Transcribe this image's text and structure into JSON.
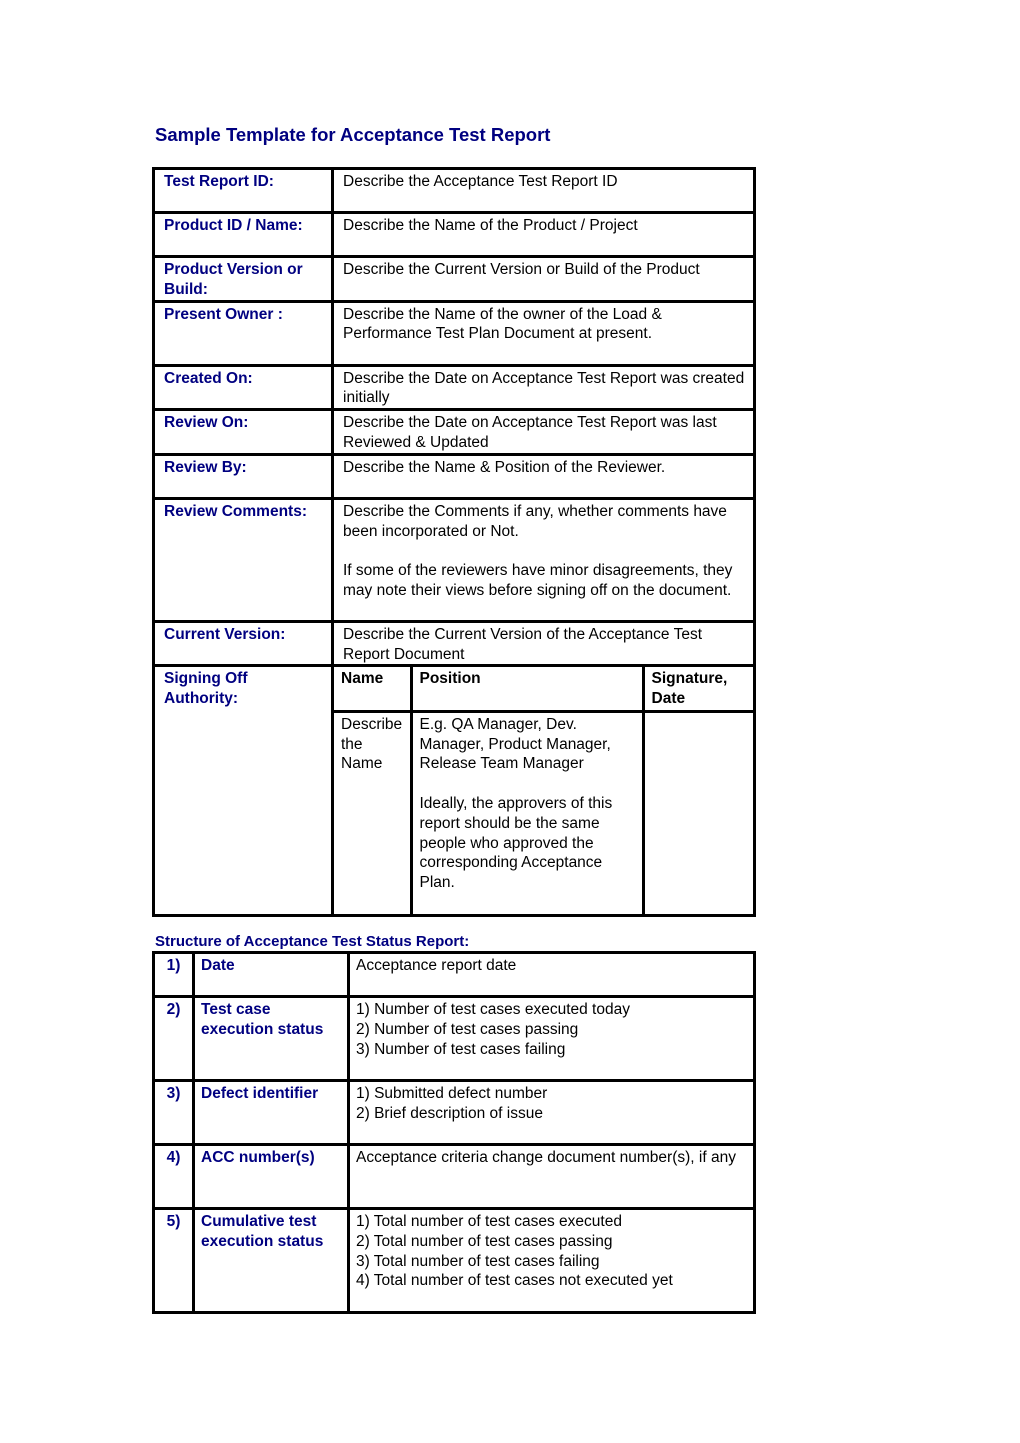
{
  "title": "Sample Template for Acceptance Test Report",
  "colors": {
    "label": "#000080",
    "text": "#000000",
    "border": "#000000"
  },
  "report_table": {
    "rows": [
      {
        "label": "Test Report ID:",
        "value": [
          "Describe the Acceptance Test Report ID"
        ]
      },
      {
        "label": "Product ID / Name:",
        "value": [
          "Describe the Name of the Product / Project"
        ]
      },
      {
        "label": "Product Version or Build:",
        "value": [
          "Describe the Current Version or Build of the Product"
        ]
      },
      {
        "label": "Present Owner :",
        "value": [
          "Describe the Name of the owner of the Load & Performance Test Plan Document at present."
        ]
      },
      {
        "label": "Created On:",
        "value": [
          "Describe the Date on Acceptance Test Report was created initially"
        ]
      },
      {
        "label": "Review On:",
        "value": [
          "Describe the Date on Acceptance Test Report was last Reviewed & Updated"
        ]
      },
      {
        "label": "Review By:",
        "value": [
          "Describe the Name & Position of the Reviewer."
        ]
      },
      {
        "label": "Review Comments:",
        "value": [
          "Describe the Comments if any, whether comments have been incorporated or Not.",
          "If some of the reviewers have minor disagreements, they may note their views before signing off on the document."
        ]
      },
      {
        "label": "Current Version:",
        "value": [
          "Describe the Current Version of the Acceptance Test Report Document"
        ]
      }
    ],
    "signing_off": {
      "label": "Signing Off Authority:",
      "headers": [
        "Name",
        "Position",
        "Signature, Date"
      ],
      "row": {
        "name": "Describe the Name",
        "position": [
          "E.g. QA Manager, Dev. Manager, Product Manager, Release Team Manager",
          "Ideally, the approvers of this report should be the same people who approved the corresponding Acceptance Plan."
        ],
        "signature": ""
      }
    }
  },
  "status_section": {
    "title": "Structure of Acceptance Test Status Report:",
    "rows": [
      {
        "num": "1)",
        "label": "Date",
        "lines": [
          "Acceptance report date"
        ]
      },
      {
        "num": "2)",
        "label": "Test case execution status",
        "lines": [
          "1) Number of test cases executed today",
          "2) Number of test cases passing",
          "3) Number of test cases failing"
        ]
      },
      {
        "num": "3)",
        "label": "Defect identifier",
        "lines": [
          "1) Submitted defect number",
          "2) Brief description of issue"
        ]
      },
      {
        "num": "4)",
        "label": "ACC number(s)",
        "lines": [
          "Acceptance criteria change document number(s), if any"
        ]
      },
      {
        "num": "5)",
        "label": "Cumulative test execution status",
        "lines": [
          "1) Total number of test cases executed",
          "2) Total number of test cases passing",
          "3) Total number of test cases failing",
          "4) Total number of test cases not executed yet"
        ]
      }
    ]
  }
}
